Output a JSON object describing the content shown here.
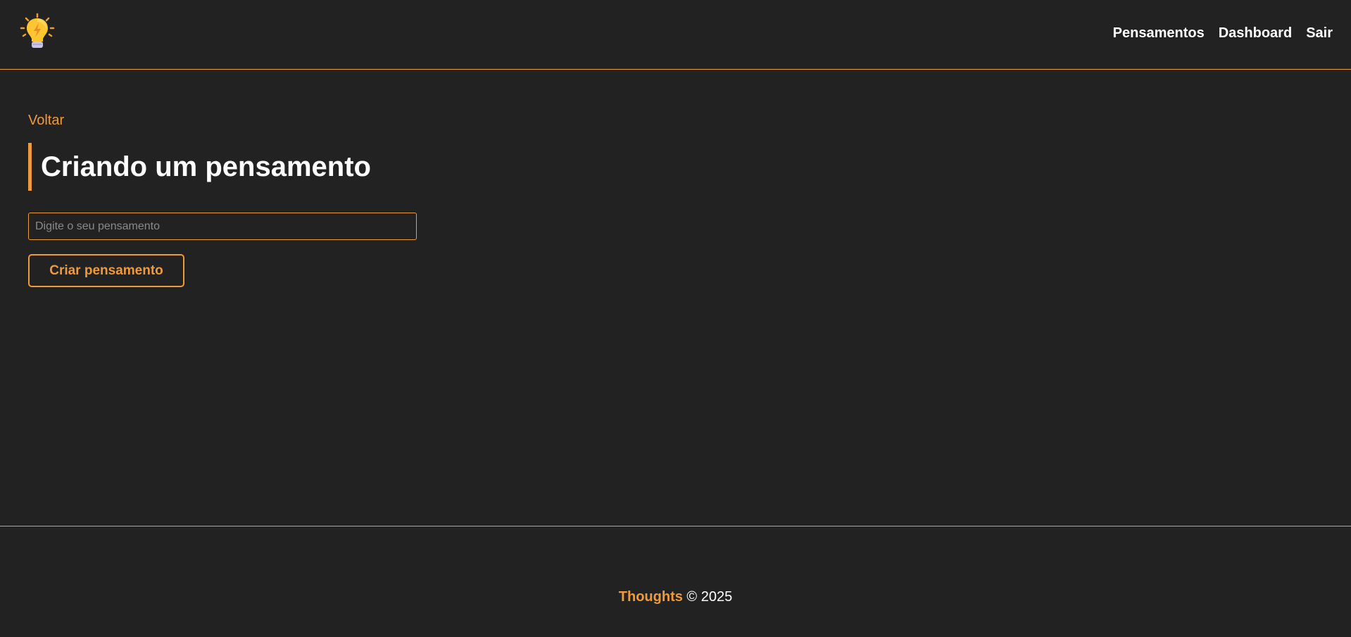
{
  "navbar": {
    "logo_icon": "lightbulb-icon",
    "links": [
      "Pensamentos",
      "Dashboard",
      "Sair"
    ]
  },
  "main": {
    "back_label": "Voltar",
    "title": "Criando um pensamento",
    "input_placeholder": "Digite o seu pensamento",
    "input_value": "",
    "submit_label": "Criar pensamento"
  },
  "footer": {
    "brand": "Thoughts",
    "copyright": "© 2025"
  },
  "colors": {
    "background": "#222222",
    "accent": "#ef9a3c",
    "text": "#ffffff"
  }
}
